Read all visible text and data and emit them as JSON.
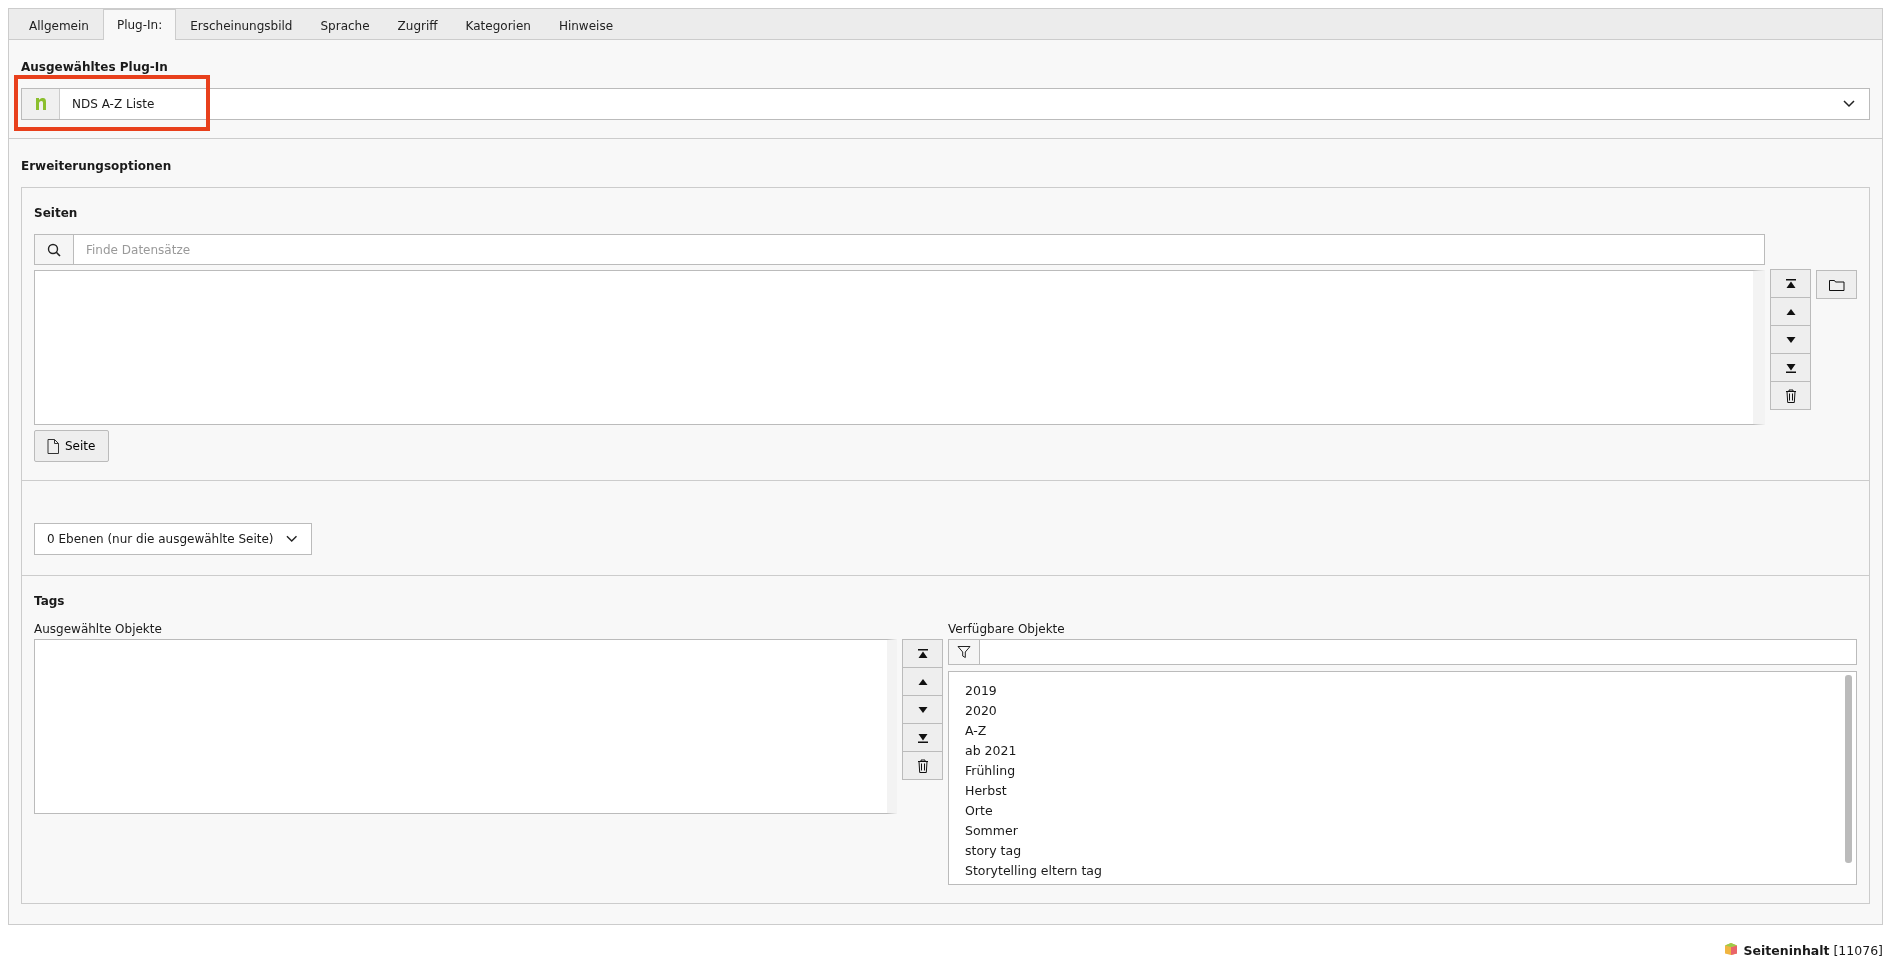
{
  "tabs": [
    {
      "label": "Allgemein",
      "selected": false
    },
    {
      "label": "Plug-In:",
      "selected": true
    },
    {
      "label": "Erscheinungsbild",
      "selected": false
    },
    {
      "label": "Sprache",
      "selected": false
    },
    {
      "label": "Zugriff",
      "selected": false
    },
    {
      "label": "Kategorien",
      "selected": false
    },
    {
      "label": "Hinweise",
      "selected": false
    }
  ],
  "plugin": {
    "label": "Ausgewähltes Plug-In",
    "value": "NDS A-Z Liste",
    "highlighted": true
  },
  "extension": {
    "title": "Erweiterungsoptionen",
    "pages": {
      "label": "Seiten",
      "search_placeholder": "Finde Datensätze",
      "add_button": "Seite"
    },
    "depth": {
      "value": "0 Ebenen (nur die ausgewählte Seite)"
    },
    "tags": {
      "label": "Tags",
      "selected_label": "Ausgewählte Objekte",
      "available_label": "Verfügbare Objekte",
      "available": [
        "2019",
        "2020",
        "A-Z",
        "ab 2021",
        "Frühling",
        "Herbst",
        "Orte",
        "Sommer",
        "story tag",
        "Storytelling eltern tag"
      ]
    }
  },
  "footer": {
    "type": "Seiteninhalt",
    "id": "[11076]"
  }
}
